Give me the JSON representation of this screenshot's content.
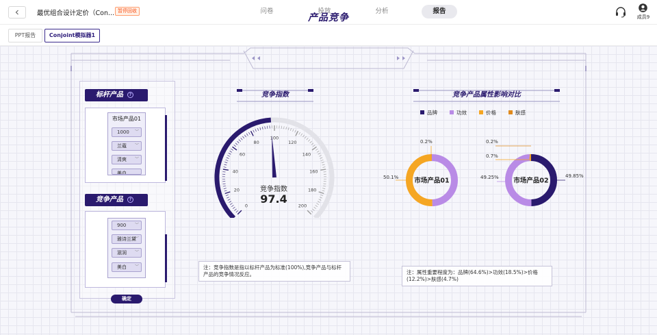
{
  "header": {
    "back_icon": "chevron-left-icon",
    "doc_title": "最优组合设计定价（Con...",
    "status_badge": "暂停回收",
    "nav": [
      {
        "label": "问卷",
        "active": false
      },
      {
        "label": "投放",
        "active": false
      },
      {
        "label": "分析",
        "active": false
      },
      {
        "label": "报告",
        "active": true
      }
    ],
    "support_icon": "headset-icon",
    "user_icon": "user-icon",
    "user_name": "成员9"
  },
  "tabs": [
    {
      "label": "PPT报告",
      "active": false
    },
    {
      "label": "Conjoint模拟器1",
      "active": true
    }
  ],
  "section": {
    "title": "产品竞争"
  },
  "benchmark": {
    "title": "标杆产品",
    "help_icon": "question-icon",
    "product_name": "市场产品01",
    "selects": [
      "1000",
      "兰蔻",
      "清爽",
      "美白"
    ]
  },
  "competitor": {
    "title": "竞争产品",
    "help_icon": "question-icon",
    "selects": [
      "900",
      "雅诗兰黛",
      "滋润",
      "美白"
    ],
    "confirm_label": "确定"
  },
  "gauge": {
    "title": "竞争指数",
    "label": "竞争指数",
    "value": 97.4,
    "value_text": "97.4",
    "min": 0,
    "max": 200,
    "ticks": [
      "0",
      "20",
      "40",
      "60",
      "80",
      "100",
      "120",
      "140",
      "160",
      "180",
      "200"
    ],
    "note": "注：竞争指数是指以标杆产品为标准(100%),竞争产品与标杆产品的竞争情况反应。"
  },
  "compare": {
    "title": "竞争产品属性影响对比",
    "legend": [
      {
        "name": "品牌",
        "color": "#2a1a6e"
      },
      {
        "name": "功效",
        "color": "#b98be6"
      },
      {
        "name": "价格",
        "color": "#f5a623"
      },
      {
        "name": "肤感",
        "color": "#e08a1e"
      }
    ],
    "note": "注：属性重要程度为：品牌(64.6%)>功效(18.5%)>价格(12.2%)>肤感(4.7%)"
  },
  "chart_data": [
    {
      "type": "pie",
      "title": "市场产品01",
      "categories": [
        "品牌",
        "功效",
        "价格",
        "肤感"
      ],
      "values": [
        0,
        49.7,
        50.1,
        0.2
      ],
      "labels": [
        "50.1%",
        "0.2%"
      ]
    },
    {
      "type": "pie",
      "title": "市场产品02",
      "categories": [
        "品牌",
        "功效",
        "价格",
        "肤感"
      ],
      "values": [
        49.85,
        49.25,
        0.7,
        0.2
      ],
      "labels": [
        "49.85%",
        "49.25%",
        "0.7%",
        "0.2%"
      ]
    }
  ]
}
